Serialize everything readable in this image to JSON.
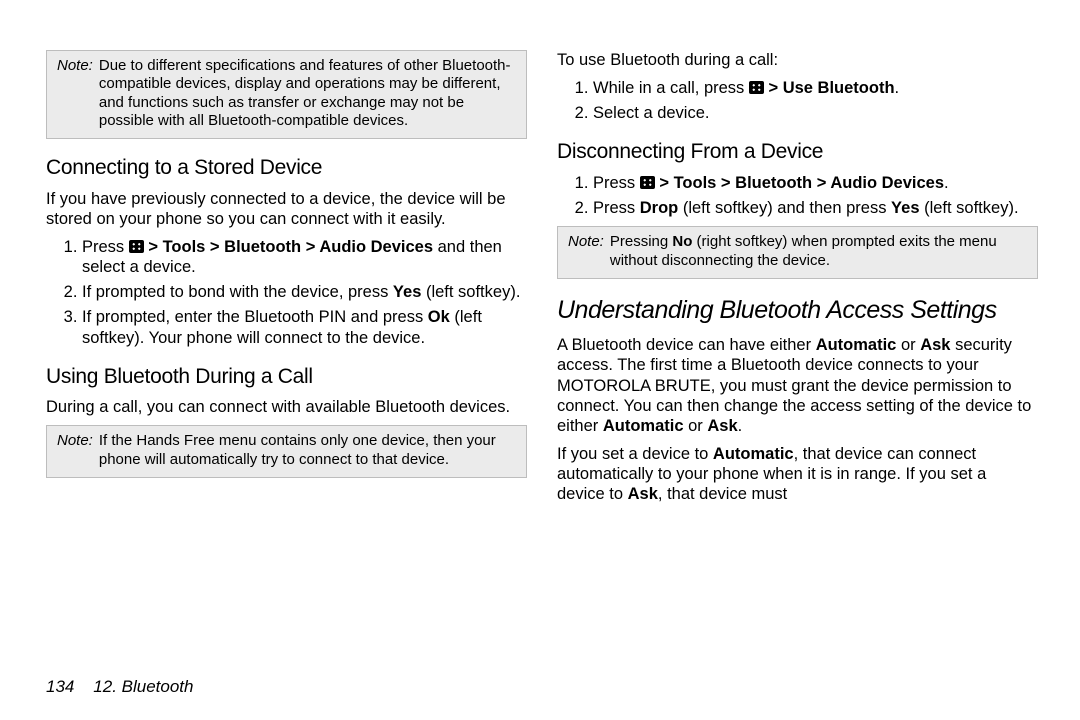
{
  "left": {
    "note1": {
      "label": "Note:",
      "text": "Due to different specifications and features of other Bluetooth-compatible devices, display and operations may be different, and functions such as transfer or exchange may not be possible with all Bluetooth-compatible devices."
    },
    "h1": "Connecting to a Stored Device",
    "p1": "If you have previously connected to a device, the device will be stored on your phone so you can connect with it easily.",
    "ol1": {
      "i1a": "Press ",
      "i1b": " > Tools > Bluetooth > Audio Devices",
      "i1c": " and then select a device.",
      "i2a": "If prompted to bond with the device, press ",
      "i2b": "Yes",
      "i2c": " (left softkey).",
      "i3a": "If prompted, enter the Bluetooth PIN and press ",
      "i3b": "Ok",
      "i3c": " (left softkey). Your phone will connect to the device."
    },
    "h2": "Using Bluetooth During a Call",
    "p2": "During a call, you can connect with available Bluetooth devices.",
    "note2": {
      "label": "Note:",
      "text": "If the Hands Free menu contains only one device, then your phone will automatically try to connect to that device."
    }
  },
  "right": {
    "p0": "To use Bluetooth during a call:",
    "ol1": {
      "i1a": "While in a call, press ",
      "i1b": " > Use Bluetooth",
      "i1c": ".",
      "i2": "Select a device."
    },
    "h1": "Disconnecting From a Device",
    "ol2": {
      "i1a": "Press ",
      "i1b": " > Tools > Bluetooth > Audio Devices",
      "i1c": ".",
      "i2a": "Press ",
      "i2b": "Drop",
      "i2c": " (left softkey) and then press ",
      "i2d": "Yes",
      "i2e": " (left softkey)."
    },
    "note1": {
      "label": "Note:",
      "text_a": "Pressing ",
      "text_b": "No",
      "text_c": " (right softkey) when prompted exits the menu without disconnecting the device."
    },
    "h2": "Understanding Bluetooth Access Settings",
    "p1a": "A Bluetooth device can have either ",
    "p1b": "Automatic",
    "p1c": " or ",
    "p1d": "Ask",
    "p1e": " security access. The first time a Bluetooth device connects to your MOTOROLA BRUTE, you must grant the device permission to connect. You can then change the access setting of the device to either ",
    "p1f": "Automatic",
    "p1g": " or ",
    "p1h": "Ask",
    "p1i": ".",
    "p2a": "If you set a device to ",
    "p2b": "Automatic",
    "p2c": ", that device can connect automatically to your phone when it is in range. If you set a device to ",
    "p2d": "Ask",
    "p2e": ", that device must"
  },
  "footer": {
    "page": "134",
    "chapter": "12. Bluetooth"
  }
}
